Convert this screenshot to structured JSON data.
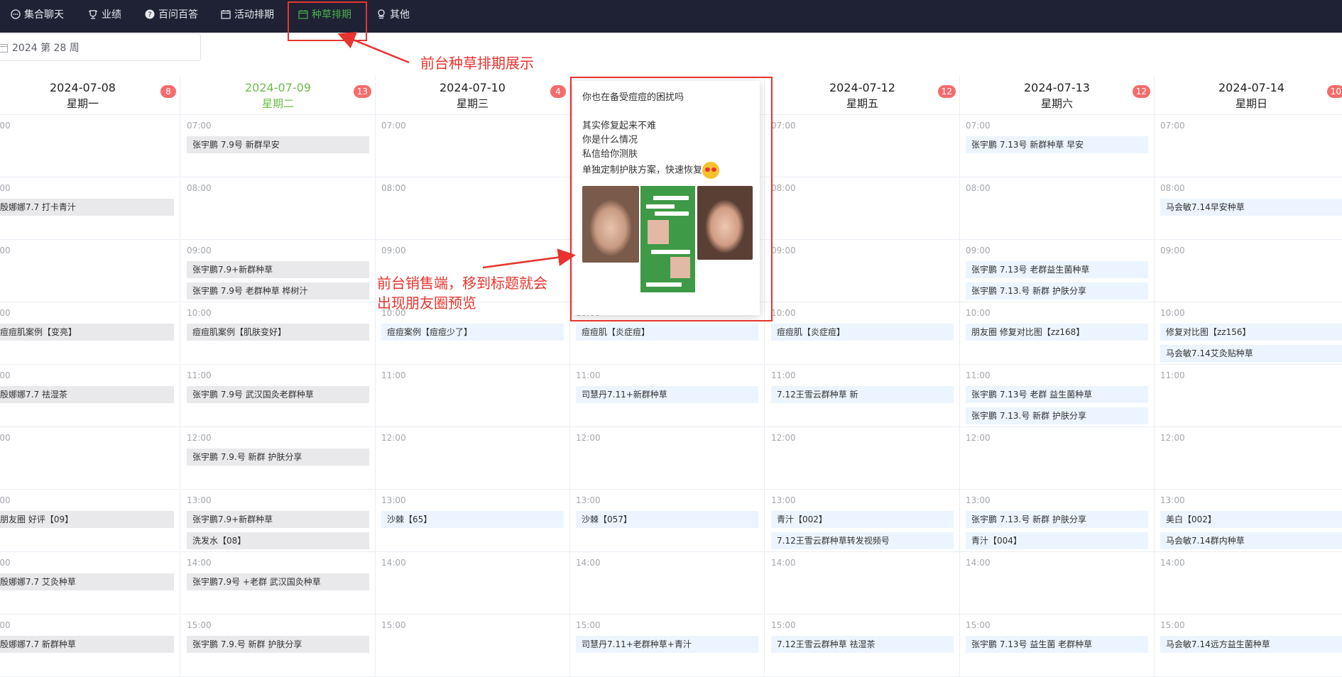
{
  "nav": {
    "items": [
      {
        "label": "集合聊天",
        "icon": "chat-icon"
      },
      {
        "label": "业绩",
        "icon": "trophy-icon"
      },
      {
        "label": "百问百答",
        "icon": "question-icon"
      },
      {
        "label": "活动排期",
        "icon": "calendar-icon"
      },
      {
        "label": "种草排期",
        "icon": "calendar-icon",
        "active": true
      },
      {
        "label": "其他",
        "icon": "misc-icon"
      }
    ],
    "active_color": "#4caf50"
  },
  "week_picker": {
    "value": "2024 第 28 周"
  },
  "calendar": {
    "days": [
      {
        "date": "2024-07-08",
        "weekday": "星期一",
        "count": "8"
      },
      {
        "date": "2024-07-09",
        "weekday": "星期二",
        "count": "13",
        "today": true
      },
      {
        "date": "2024-07-10",
        "weekday": "星期三",
        "count": "4"
      },
      {
        "date": "",
        "weekday": "",
        "count": ""
      },
      {
        "date": "2024-07-12",
        "weekday": "星期五",
        "count": "12"
      },
      {
        "date": "2024-07-13",
        "weekday": "星期六",
        "count": "12"
      },
      {
        "date": "2024-07-14",
        "weekday": "星期日",
        "count": "10"
      }
    ],
    "time_labels": [
      "07:00",
      "08:00",
      "09:00",
      "10:00",
      "11:00",
      "12:00",
      "13:00",
      "14:00",
      "15:00"
    ],
    "events": [
      {
        "day": 0,
        "slot": 1,
        "idx": 0,
        "text": "殷娜娜7.7 打卡青汁",
        "style": "gray"
      },
      {
        "day": 0,
        "slot": 3,
        "idx": 0,
        "text": "痘痘肌案例【变亮】",
        "style": "gray"
      },
      {
        "day": 0,
        "slot": 4,
        "idx": 0,
        "text": "殷娜娜7.7 祛湿茶",
        "style": "gray"
      },
      {
        "day": 0,
        "slot": 6,
        "idx": 0,
        "text": "朋友圈 好评【09】",
        "style": "gray"
      },
      {
        "day": 0,
        "slot": 7,
        "idx": 0,
        "text": "殷娜娜7.7 艾灸种草",
        "style": "gray"
      },
      {
        "day": 0,
        "slot": 8,
        "idx": 0,
        "text": "殷娜娜7.7 新群种草",
        "style": "gray"
      },
      {
        "day": 1,
        "slot": 0,
        "idx": 0,
        "text": "张宇鹏 7.9号 新群早安",
        "style": "gray"
      },
      {
        "day": 1,
        "slot": 2,
        "idx": 0,
        "text": "张宇鹏7.9+新群种草",
        "style": "gray"
      },
      {
        "day": 1,
        "slot": 2,
        "idx": 1,
        "text": "张宇鹏 7.9号 老群种草 桦树汁",
        "style": "gray"
      },
      {
        "day": 1,
        "slot": 3,
        "idx": 0,
        "text": "痘痘肌案例【肌肤变好】",
        "style": "gray"
      },
      {
        "day": 1,
        "slot": 4,
        "idx": 0,
        "text": "张宇鹏 7.9号 武汉国灸老群种草",
        "style": "gray"
      },
      {
        "day": 1,
        "slot": 5,
        "idx": 0,
        "text": "张宇鹏 7.9.号 新群 护肤分享",
        "style": "gray"
      },
      {
        "day": 1,
        "slot": 6,
        "idx": 0,
        "text": "张宇鹏7.9+新群种草",
        "style": "gray"
      },
      {
        "day": 1,
        "slot": 6,
        "idx": 1,
        "text": "洗发水【08】",
        "style": "gray"
      },
      {
        "day": 1,
        "slot": 7,
        "idx": 0,
        "text": "张宇鹏7.9号 +老群 武汉国灸种草",
        "style": "gray"
      },
      {
        "day": 1,
        "slot": 8,
        "idx": 0,
        "text": "张宇鹏 7.9.号 新群 护肤分享",
        "style": "gray"
      },
      {
        "day": 2,
        "slot": 3,
        "idx": 0,
        "text": "痘痘案例【痘痘少了】",
        "style": "blue"
      },
      {
        "day": 2,
        "slot": 6,
        "idx": 0,
        "text": "沙棘【65】",
        "style": "blue"
      },
      {
        "day": 3,
        "slot": 3,
        "idx": 0,
        "text": "痘痘肌【炎症痘】",
        "style": "blue"
      },
      {
        "day": 3,
        "slot": 4,
        "idx": 0,
        "text": "司慧丹7.11+新群种草",
        "style": "blue"
      },
      {
        "day": 3,
        "slot": 6,
        "idx": 0,
        "text": "沙棘【057】",
        "style": "blue"
      },
      {
        "day": 3,
        "slot": 8,
        "idx": 0,
        "text": "司慧丹7.11+老群种草+青汁",
        "style": "blue"
      },
      {
        "day": 4,
        "slot": 3,
        "idx": 0,
        "text": "痘痘肌【炎症痘】",
        "style": "blue"
      },
      {
        "day": 4,
        "slot": 4,
        "idx": 0,
        "text": "7.12王雪云群种草 新",
        "style": "blue"
      },
      {
        "day": 4,
        "slot": 6,
        "idx": 0,
        "text": "青汁【002】",
        "style": "blue"
      },
      {
        "day": 4,
        "slot": 6,
        "idx": 1,
        "text": "7.12王雪云群种草转发视频号",
        "style": "blue"
      },
      {
        "day": 4,
        "slot": 8,
        "idx": 0,
        "text": "7.12王雪云群种草 祛湿茶",
        "style": "blue"
      },
      {
        "day": 5,
        "slot": 0,
        "idx": 0,
        "text": "张宇鹏 7.13号 新群种草 早安",
        "style": "blue"
      },
      {
        "day": 5,
        "slot": 2,
        "idx": 0,
        "text": "张宇鹏 7.13号 老群益生菌种草",
        "style": "blue"
      },
      {
        "day": 5,
        "slot": 2,
        "idx": 1,
        "text": "张宇鹏 7.13.号 新群 护肤分享",
        "style": "blue"
      },
      {
        "day": 5,
        "slot": 3,
        "idx": 0,
        "text": "朋友圈 修复对比图【zz168】",
        "style": "blue"
      },
      {
        "day": 5,
        "slot": 4,
        "idx": 0,
        "text": "张宇鹏 7.13号 老群 益生菌种草",
        "style": "blue"
      },
      {
        "day": 5,
        "slot": 4,
        "idx": 1,
        "text": "张宇鹏 7.13.号 新群 护肤分享",
        "style": "blue"
      },
      {
        "day": 5,
        "slot": 6,
        "idx": 0,
        "text": "张宇鹏 7.13.号 新群 护肤分享",
        "style": "blue"
      },
      {
        "day": 5,
        "slot": 6,
        "idx": 1,
        "text": "青汁【004】",
        "style": "blue"
      },
      {
        "day": 5,
        "slot": 8,
        "idx": 0,
        "text": "张宇鹏 7.13号 益生菌 老群种草",
        "style": "blue"
      },
      {
        "day": 6,
        "slot": 1,
        "idx": 0,
        "text": "马会敏7.14早安种草",
        "style": "blue"
      },
      {
        "day": 6,
        "slot": 3,
        "idx": 0,
        "text": "修复对比图【zz156】",
        "style": "blue"
      },
      {
        "day": 6,
        "slot": 3,
        "idx": 1,
        "text": "马会敏7.14艾灸贴种草",
        "style": "blue"
      },
      {
        "day": 6,
        "slot": 6,
        "idx": 0,
        "text": "美白【002】",
        "style": "blue"
      },
      {
        "day": 6,
        "slot": 6,
        "idx": 1,
        "text": "马会敏7.14群内种草",
        "style": "blue"
      },
      {
        "day": 6,
        "slot": 8,
        "idx": 0,
        "text": "马会敏7.14远方益生菌种草",
        "style": "blue"
      }
    ]
  },
  "popup": {
    "lines": [
      "你也在备受痘痘的困扰吗",
      "",
      "其实修复起来不难",
      "你是什么情况",
      "私信给你测肤",
      "单独定制护肤方案，快速恢复"
    ],
    "emoji": "star-struck-emoji"
  },
  "annotations": {
    "top": "前台种草排期展示",
    "side_line1": "前台销售端，移到标题就会",
    "side_line2": "出现朋友圈预览",
    "color": "#e8342e"
  }
}
